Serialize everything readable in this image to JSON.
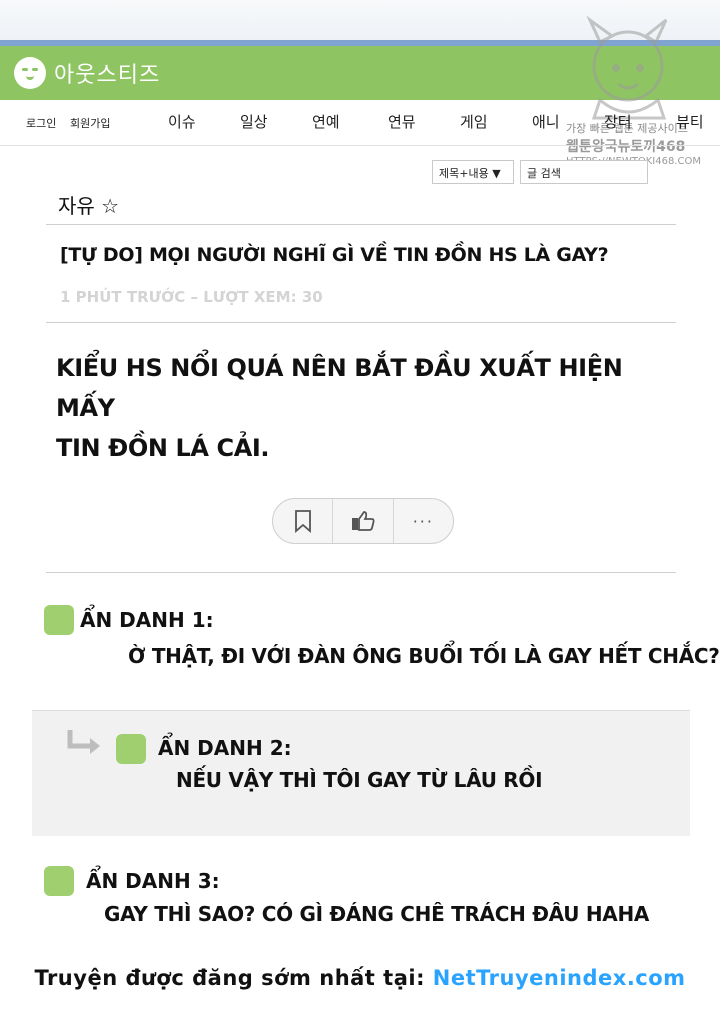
{
  "site": {
    "logo_text": "아웃스티즈",
    "brand_color": "#8fc463"
  },
  "watermark": {
    "line1": "가장 빠른 웹툰 제공사이트",
    "line2": "웹툰왕국뉴토끼468",
    "line3": "HTTPS://NEWTOKI468.COM"
  },
  "nav": {
    "login": "로그인",
    "signup": "회원가입",
    "items": [
      "이슈",
      "일상",
      "연예",
      "연뮤",
      "게임",
      "애니",
      "장터",
      "뷰티"
    ]
  },
  "search": {
    "select_value": "제목+내용 ▼",
    "placeholder": "글 검색"
  },
  "board": {
    "title": "자유 ☆"
  },
  "post": {
    "title": "[TỰ DO] MỌI NGƯỜI NGHĨ GÌ VỀ TIN ĐỒN HS LÀ GAY?",
    "meta": "1 PHÚT TRƯỚC – LƯỢT XEM: 30",
    "body_line1": "KIỂU HS NỔI QUÁ NÊN BẮT ĐẦU XUẤT HIỆN MẤY",
    "body_line2": "TIN ĐỒN LÁ CẢI."
  },
  "actions": {
    "more_label": "···",
    "icons": [
      "bookmark-icon",
      "like-icon",
      "more-icon"
    ]
  },
  "comments": [
    {
      "name": "ẨN DANH 1:",
      "text": "Ờ THẬT, ĐI VỚI ĐÀN ÔNG BUỔI TỐI LÀ GAY HẾT CHẮC?"
    },
    {
      "name": "ẨN DANH 2:",
      "text": "NẾU VẬY THÌ TÔI GAY TỪ LÂU RỒI"
    },
    {
      "name": "ẨN DANH 3:",
      "text": "GAY THÌ SAO? CÓ GÌ ĐÁNG CHÊ TRÁCH ĐÂU HAHA"
    }
  ],
  "footer": {
    "prefix": "Truyện được đăng sớm nhất tại: ",
    "site": "NetTruyenindex.com"
  }
}
